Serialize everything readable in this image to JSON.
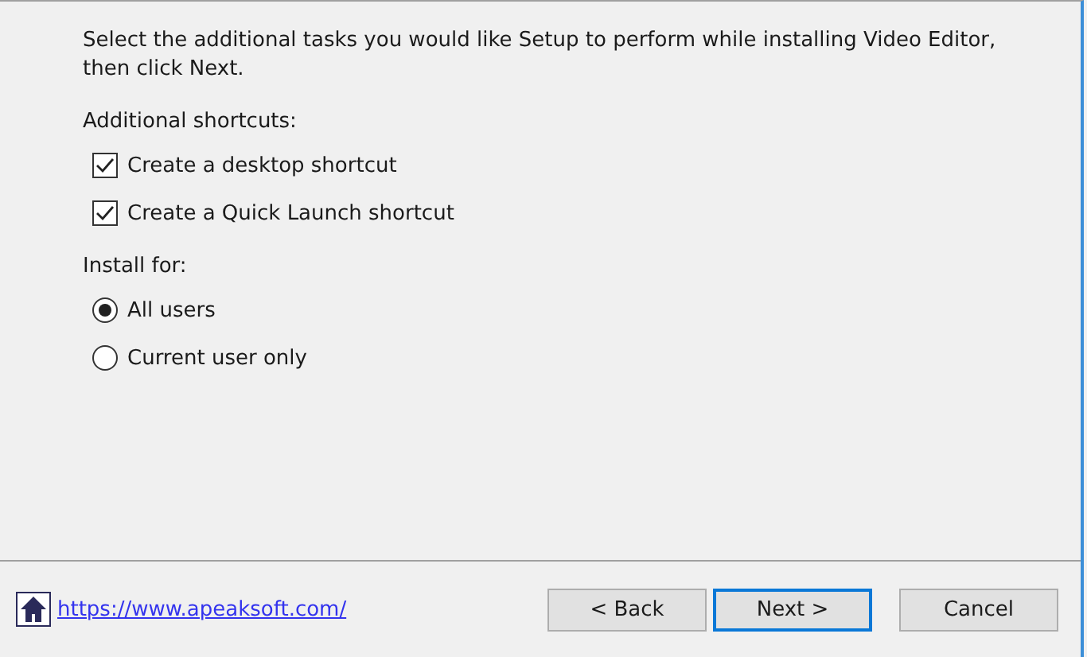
{
  "instruction": "Select the additional tasks you would like Setup to perform while installing Video Editor, then click Next.",
  "groups": [
    {
      "label": "Additional shortcuts:",
      "options": [
        {
          "kind": "checkbox",
          "label": "Create a desktop shortcut",
          "checked": true
        },
        {
          "kind": "checkbox",
          "label": "Create a Quick Launch shortcut",
          "checked": true
        }
      ]
    },
    {
      "label": "Install for:",
      "options": [
        {
          "kind": "radio",
          "label": "All users",
          "selected": true
        },
        {
          "kind": "radio",
          "label": "Current user only",
          "selected": false
        }
      ]
    }
  ],
  "link": "https://www.apeaksoft.com/",
  "buttons": [
    {
      "label": "< Back",
      "default": false
    },
    {
      "label": "Next >",
      "default": true
    },
    {
      "label": "Cancel",
      "default": false
    }
  ]
}
